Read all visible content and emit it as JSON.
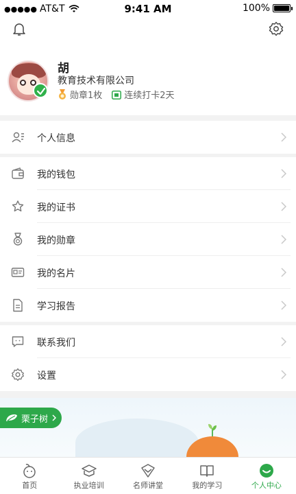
{
  "status_bar": {
    "carrier": "AT&T",
    "time": "9:41 AM",
    "battery": "100%"
  },
  "profile": {
    "name": "胡",
    "company": "教育技术有限公司",
    "medals": "勋章1枚",
    "checkin": "连续打卡2天"
  },
  "menu": {
    "personal_info": "个人信息",
    "wallet": "我的钱包",
    "certificates": "我的证书",
    "medals": "我的勋章",
    "business_card": "我的名片",
    "study_report": "学习报告",
    "contact": "联系我们",
    "settings": "设置"
  },
  "banner": {
    "label": "栗子树"
  },
  "tabbar": {
    "items": [
      {
        "label": "首页",
        "icon": "home-icon"
      },
      {
        "label": "执业培训",
        "icon": "training-icon"
      },
      {
        "label": "名师讲堂",
        "icon": "lecture-icon"
      },
      {
        "label": "我的学习",
        "icon": "book-icon"
      },
      {
        "label": "个人中心",
        "icon": "profile-icon"
      }
    ],
    "active_index": 4
  },
  "colors": {
    "accent": "#2da84a",
    "background": "#f2f2f2"
  }
}
